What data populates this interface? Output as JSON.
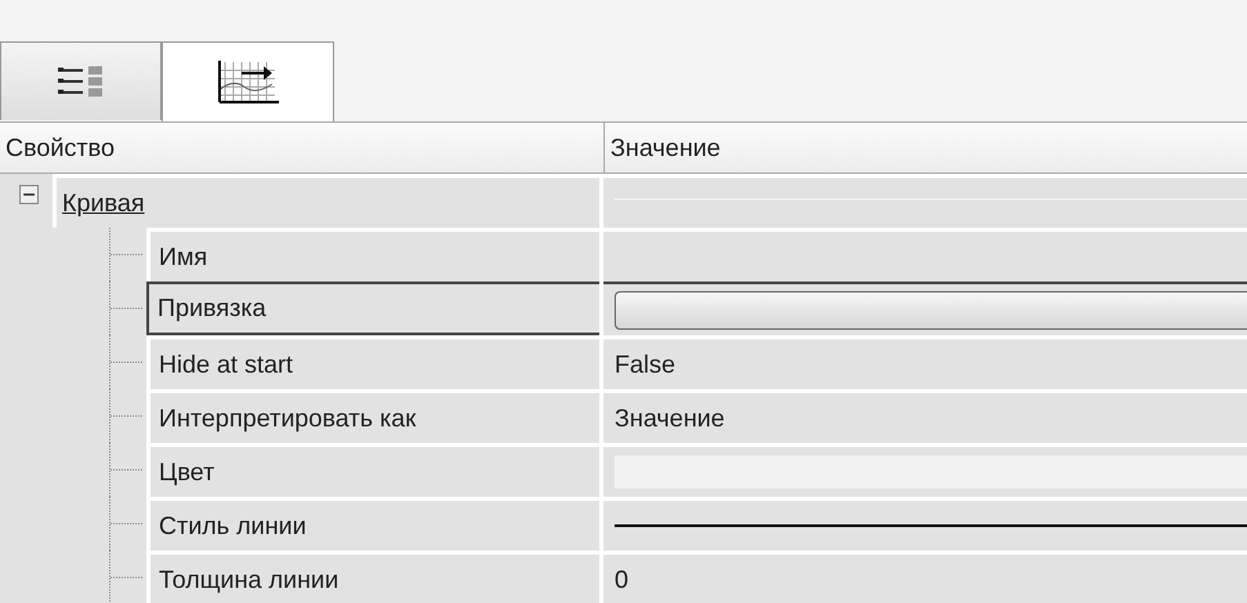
{
  "tabs": [
    {
      "kind": "list",
      "selected": false
    },
    {
      "kind": "chart",
      "selected": true
    }
  ],
  "columns": [
    "Свойство",
    "Значение"
  ],
  "properties": [
    {
      "name": "Кривая",
      "expanded": true,
      "kind": "category",
      "selected": false,
      "children": [
        {
          "name": "Имя",
          "kind": "empty",
          "selected": false
        },
        {
          "name": "Привязка",
          "kind": "button",
          "selected": true
        },
        {
          "name": "Hide at start",
          "kind": "text",
          "value": "False",
          "selected": false
        },
        {
          "name": "Интерпретировать как",
          "kind": "text",
          "value": "Значение",
          "selected": false
        },
        {
          "name": "Цвет",
          "kind": "color",
          "selected": false
        },
        {
          "name": "Стиль линии",
          "kind": "line",
          "selected": false
        },
        {
          "name": "Толщина линии",
          "kind": "text",
          "value": "0",
          "selected": false
        }
      ]
    }
  ]
}
